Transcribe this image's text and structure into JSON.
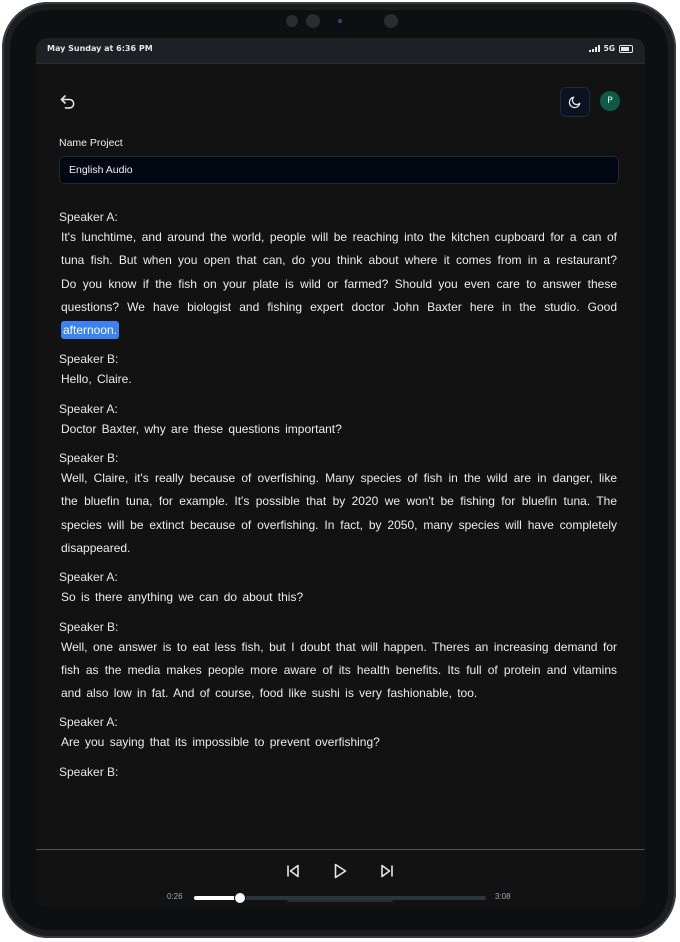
{
  "status_bar": {
    "time": "May Sunday at 6:36 PM",
    "network": "5G"
  },
  "avatar_initial": "P",
  "project": {
    "label": "Name Project",
    "value": "English Audio"
  },
  "transcript": [
    {
      "speaker": "Speaker A:",
      "text": "It's lunchtime, and around the world, people will be reaching into the kitchen cupboard for a can of tuna fish. But when you open that can, do you think about where it comes from in a restaurant? Do you know if the fish on your plate is wild or farmed? Should you even care to answer these questions? We have biologist and fishing expert doctor John Baxter here in the studio. Good",
      "highlight": "afternoon."
    },
    {
      "speaker": "Speaker B:",
      "text": "Hello, Claire."
    },
    {
      "speaker": "Speaker A:",
      "text": "Doctor Baxter, why are these questions important?"
    },
    {
      "speaker": "Speaker B:",
      "text": "Well, Claire, it's really because of overfishing. Many species of fish in the wild are in danger, like the bluefin tuna, for example. It's possible that by 2020 we won't be fishing for bluefin tuna. The species will be extinct because of overfishing. In fact, by 2050, many species will have completely disappeared."
    },
    {
      "speaker": "Speaker A:",
      "text": "So is there anything we can do about this?"
    },
    {
      "speaker": "Speaker B:",
      "text": "Well, one answer is to eat less fish, but I doubt that will happen. Theres an increasing demand for fish as the media makes people more aware of its health benefits. Its full of protein and vitamins and also low in fat. And of course, food like sushi is very fashionable, too."
    },
    {
      "speaker": "Speaker A:",
      "text": "Are you saying that its impossible to prevent overfishing?"
    },
    {
      "speaker": "Speaker B:",
      "text": ""
    }
  ],
  "player": {
    "current_time": "0:26",
    "duration": "3:08",
    "progress": 0.156
  },
  "icons": {
    "back": "undo-arrow-icon",
    "theme": "moon-icon",
    "prev": "skip-back-icon",
    "play": "play-icon",
    "next": "skip-forward-icon"
  }
}
